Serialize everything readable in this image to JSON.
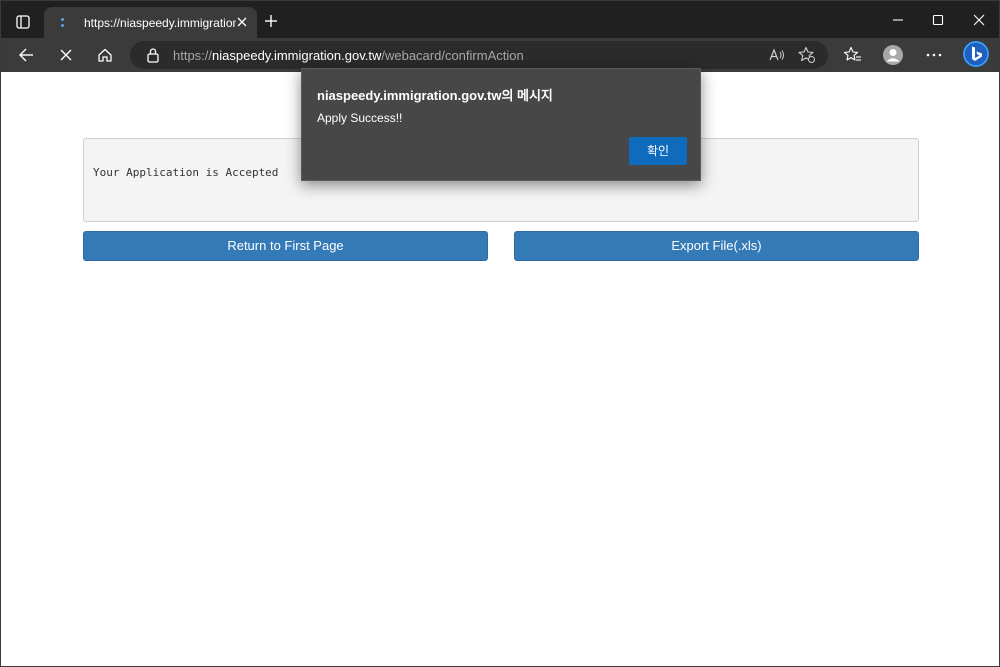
{
  "browser": {
    "tab_title": "https://niaspeedy.immigration.gov.tw/webacard/confirmAction",
    "url_scheme": "https://",
    "url_host": "niaspeedy.immigration.gov.tw",
    "url_path": "/webacard/confirmAction"
  },
  "page": {
    "panel_text": "Your Application is Accepted",
    "return_button": "Return to First Page",
    "export_button": "Export File(.xls)"
  },
  "dialog": {
    "title": "niaspeedy.immigration.gov.tw의 메시지",
    "message": "Apply Success!!",
    "ok_label": "확인"
  },
  "colors": {
    "button_blue": "#337ab7",
    "dialog_ok": "#0f6cbd",
    "dialog_bg": "#474747"
  }
}
